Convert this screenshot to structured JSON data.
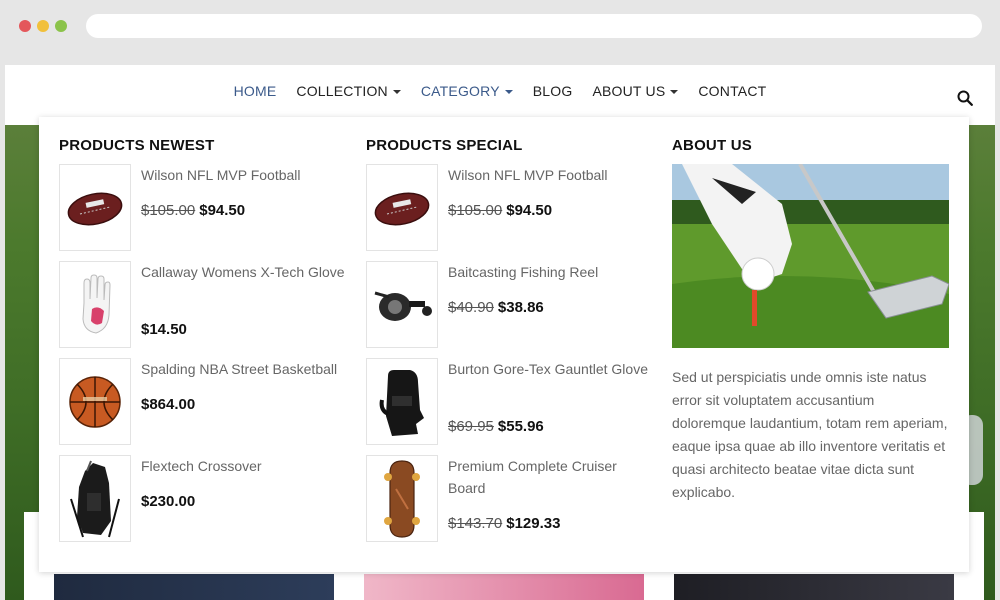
{
  "nav": {
    "items": [
      {
        "label": "HOME",
        "caret": false,
        "active": true
      },
      {
        "label": "COLLECTION",
        "caret": true,
        "active": false
      },
      {
        "label": "CATEGORY",
        "caret": true,
        "active": true
      },
      {
        "label": "BLOG",
        "caret": false,
        "active": false
      },
      {
        "label": "ABOUT US",
        "caret": true,
        "active": false
      },
      {
        "label": "CONTACT",
        "caret": false,
        "active": false
      }
    ],
    "search_icon": "search-icon"
  },
  "mega": {
    "newest": {
      "title": "PRODUCTS NEWEST",
      "products": [
        {
          "name": "Wilson NFL MVP Football",
          "old_price": "$105.00",
          "price": "$94.50",
          "icon": "football-icon"
        },
        {
          "name": "Callaway Womens X-Tech Glove",
          "old_price": "",
          "price": "$14.50",
          "icon": "glove-icon"
        },
        {
          "name": "Spalding NBA Street Basketball",
          "old_price": "",
          "price": "$864.00",
          "icon": "basketball-icon"
        },
        {
          "name": "Flextech Crossover",
          "old_price": "",
          "price": "$230.00",
          "icon": "golf-bag-icon"
        }
      ]
    },
    "special": {
      "title": "PRODUCTS SPECIAL",
      "products": [
        {
          "name": "Wilson NFL MVP Football",
          "old_price": "$105.00",
          "price": "$94.50",
          "icon": "football-icon"
        },
        {
          "name": "Baitcasting Fishing Reel",
          "old_price": "$40.90",
          "price": "$38.86",
          "icon": "fishing-reel-icon"
        },
        {
          "name": "Burton Gore-Tex Gauntlet Glove",
          "old_price": "$69.95",
          "price": "$55.96",
          "icon": "gauntlet-glove-icon"
        },
        {
          "name": "Premium Complete Cruiser Board",
          "old_price": "$143.70",
          "price": "$129.33",
          "icon": "skateboard-icon"
        }
      ]
    },
    "about": {
      "title": "ABOUT US",
      "text": "Sed ut perspiciatis unde omnis iste natus error sit voluptatem accusantium doloremque laudantium, totam rem aperiam, eaque ipsa quae ab illo inventore veritatis et quasi architecto beatae vitae dicta sunt explicabo."
    }
  },
  "colors": {
    "accent": "#3b5a8a",
    "text": "#222222",
    "muted": "#666666"
  }
}
